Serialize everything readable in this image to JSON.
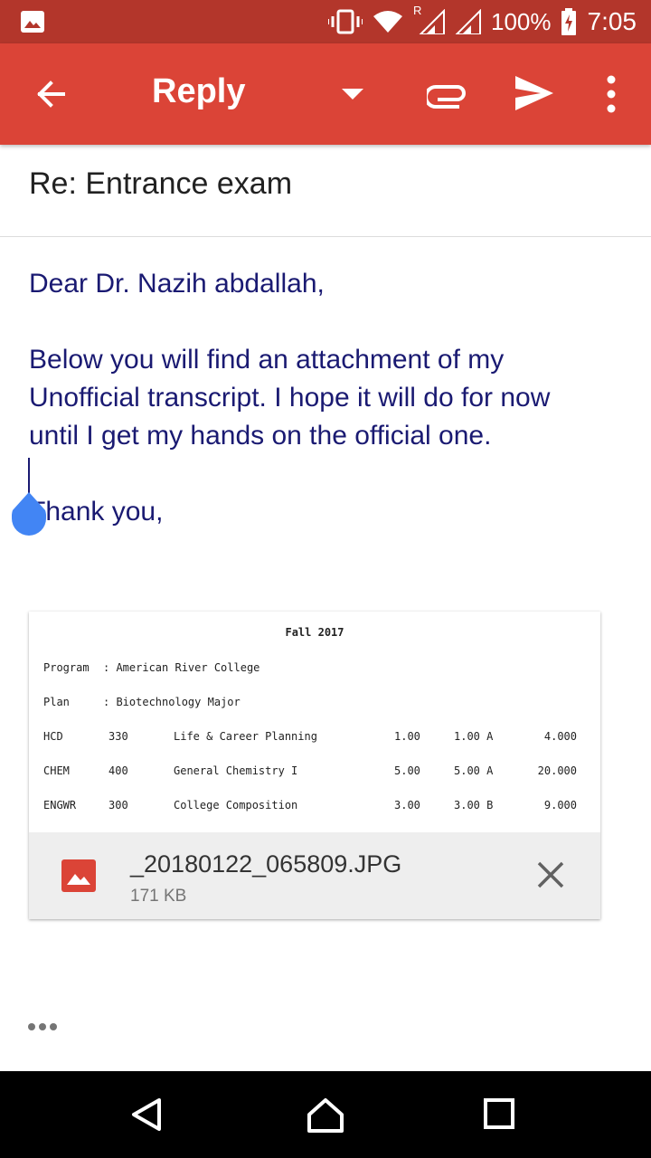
{
  "status_bar": {
    "battery": "100%",
    "time": "7:05",
    "roaming_indicator": "R"
  },
  "toolbar": {
    "title": "Reply",
    "icons": [
      "back-arrow-icon",
      "dropdown-icon",
      "attach-icon",
      "send-icon",
      "more-vert-icon"
    ]
  },
  "compose": {
    "subject": "Re: Entrance exam",
    "greeting": "Dear Dr. Nazih abdallah,",
    "paragraph_lines": [
      "Below you will find an attachment of my",
      "Unofficial transcript. I hope it will do for now",
      "until I get my hands on the official one."
    ],
    "closing": "Thank you,"
  },
  "attachment": {
    "preview": {
      "title": "Fall 2017",
      "program_label": "Program",
      "program_value": ": American River College",
      "plan_label": "Plan",
      "plan_value": ": Biotechnology Major",
      "courses": [
        {
          "dept": "HCD",
          "num": "330",
          "name": "Life & Career Planning",
          "attempted": "1.00",
          "earned": "1.00 A",
          "points": "4.000"
        },
        {
          "dept": "CHEM",
          "num": "400",
          "name": "General Chemistry I",
          "attempted": "5.00",
          "earned": "5.00 A",
          "points": "20.000"
        },
        {
          "dept": "ENGWR",
          "num": "300",
          "name": "College Composition",
          "attempted": "3.00",
          "earned": "3.00 B",
          "points": "9.000"
        }
      ]
    },
    "filename": "_20180122_065809.JPG",
    "size": "171 KB"
  },
  "colors": {
    "status_bar": "#b3362b",
    "toolbar": "#db4437",
    "body_text": "#1a1a72",
    "cursor_handle": "#4285f4"
  }
}
